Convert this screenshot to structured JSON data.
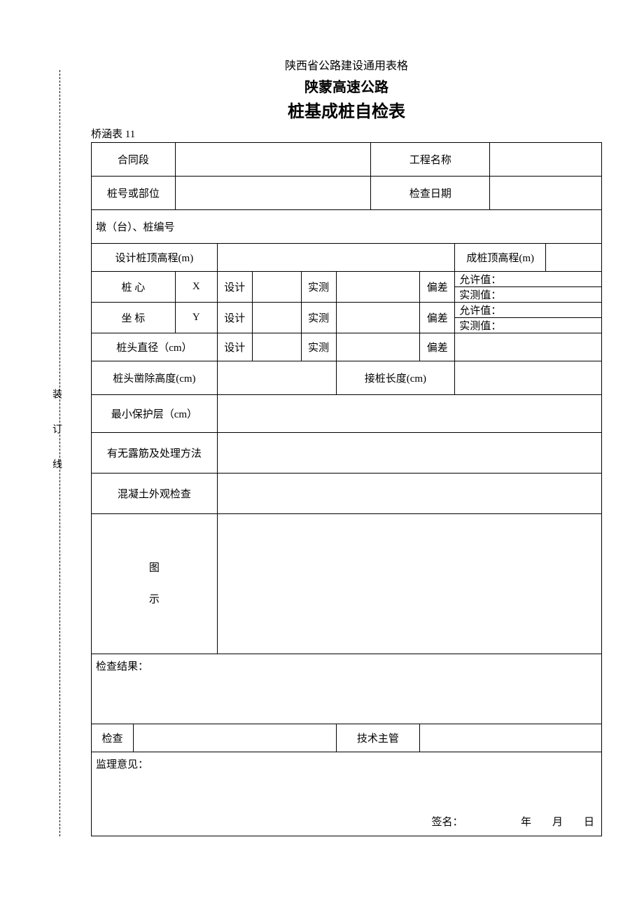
{
  "header": {
    "line1": "陕西省公路建设通用表格",
    "line2": "陕蒙高速公路",
    "line3": "桩基成桩自检表"
  },
  "form_no": "桥涵表 11",
  "binding": {
    "c1": "装",
    "c2": "订",
    "c3": "线"
  },
  "labels": {
    "contract_section": "合同段",
    "project_name": "工程名称",
    "pile_or_part": "桩号或部位",
    "check_date": "检查日期",
    "pier_pile_no": "墩（台）、桩编号",
    "design_top_elev": "设计桩顶高程(m)",
    "actual_top_elev": "成桩顶高程(m)",
    "pile_center": "桩 心",
    "coord": "坐 标",
    "x": "X",
    "y": "Y",
    "design": "设计",
    "measured": "实测",
    "deviation": "偏差",
    "allowed": "允许值：",
    "measured_val": "实测值：",
    "head_diameter": "桩头直径（cm）",
    "chisel_height": "桩头凿除高度(cm)",
    "splice_length": "接桩长度(cm)",
    "min_cover": "最小保护层（cm）",
    "exposed_rebar": "有无露筋及处理方法",
    "concrete_appearance": "混凝土外观检查",
    "diagram1": "图",
    "diagram2": "示",
    "check_result": "检查结果：",
    "checker": "检查",
    "tech_supervisor": "技术主管",
    "supervisor_opinion": "监理意见：",
    "signature_line": "签名：　　　　　　年　　月　　日"
  }
}
